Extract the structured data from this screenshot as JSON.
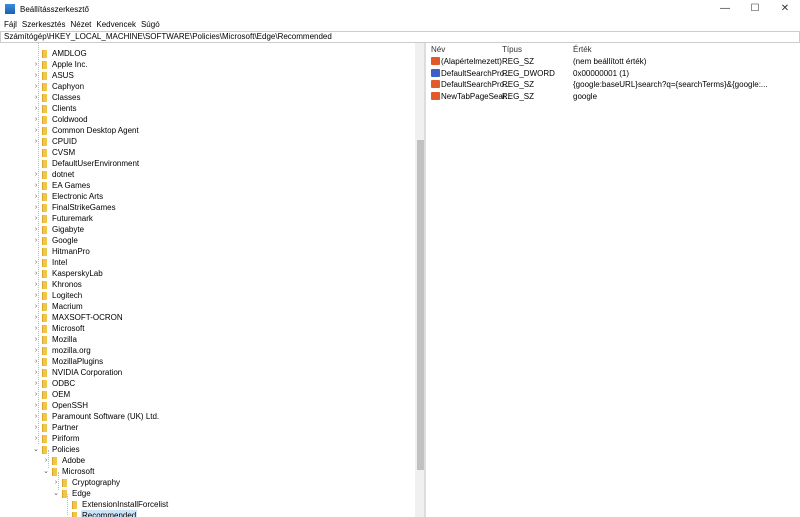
{
  "window": {
    "title": "Beállításszerkesztő",
    "minimize": "—",
    "maximize": "☐",
    "close": "✕"
  },
  "menu": [
    "Fájl",
    "Szerkesztés",
    "Nézet",
    "Kedvencek",
    "Súgó"
  ],
  "address": "Számítógép\\HKEY_LOCAL_MACHINE\\SOFTWARE\\Policies\\Microsoft\\Edge\\Recommended",
  "tree": [
    {
      "label": "AMDLOG",
      "level": 0,
      "exp": ""
    },
    {
      "label": "Apple Inc.",
      "level": 0,
      "exp": ">"
    },
    {
      "label": "ASUS",
      "level": 0,
      "exp": ">"
    },
    {
      "label": "Caphyon",
      "level": 0,
      "exp": ">"
    },
    {
      "label": "Classes",
      "level": 0,
      "exp": ">"
    },
    {
      "label": "Clients",
      "level": 0,
      "exp": ">"
    },
    {
      "label": "Coldwood",
      "level": 0,
      "exp": ">"
    },
    {
      "label": "Common Desktop Agent",
      "level": 0,
      "exp": ">"
    },
    {
      "label": "CPUID",
      "level": 0,
      "exp": ">"
    },
    {
      "label": "CVSM",
      "level": 0,
      "exp": ""
    },
    {
      "label": "DefaultUserEnvironment",
      "level": 0,
      "exp": ""
    },
    {
      "label": "dotnet",
      "level": 0,
      "exp": ">"
    },
    {
      "label": "EA Games",
      "level": 0,
      "exp": ">"
    },
    {
      "label": "Electronic Arts",
      "level": 0,
      "exp": ">"
    },
    {
      "label": "FinalStrikeGames",
      "level": 0,
      "exp": ">"
    },
    {
      "label": "Futuremark",
      "level": 0,
      "exp": ">"
    },
    {
      "label": "Gigabyte",
      "level": 0,
      "exp": ">"
    },
    {
      "label": "Google",
      "level": 0,
      "exp": ">"
    },
    {
      "label": "HitmanPro",
      "level": 0,
      "exp": ""
    },
    {
      "label": "Intel",
      "level": 0,
      "exp": ">"
    },
    {
      "label": "KasperskyLab",
      "level": 0,
      "exp": ">"
    },
    {
      "label": "Khronos",
      "level": 0,
      "exp": ">"
    },
    {
      "label": "Logitech",
      "level": 0,
      "exp": ">"
    },
    {
      "label": "Macrium",
      "level": 0,
      "exp": ">"
    },
    {
      "label": "MAXSOFT-OCRON",
      "level": 0,
      "exp": ">"
    },
    {
      "label": "Microsoft",
      "level": 0,
      "exp": ">"
    },
    {
      "label": "Mozilla",
      "level": 0,
      "exp": ">"
    },
    {
      "label": "mozilla.org",
      "level": 0,
      "exp": ">"
    },
    {
      "label": "MozillaPlugins",
      "level": 0,
      "exp": ">"
    },
    {
      "label": "NVIDIA Corporation",
      "level": 0,
      "exp": ">"
    },
    {
      "label": "ODBC",
      "level": 0,
      "exp": ">"
    },
    {
      "label": "OEM",
      "level": 0,
      "exp": ">"
    },
    {
      "label": "OpenSSH",
      "level": 0,
      "exp": ">"
    },
    {
      "label": "Paramount Software (UK) Ltd.",
      "level": 0,
      "exp": ">"
    },
    {
      "label": "Partner",
      "level": 0,
      "exp": ">"
    },
    {
      "label": "Piriform",
      "level": 0,
      "exp": ">"
    },
    {
      "label": "Policies",
      "level": 0,
      "exp": "v"
    },
    {
      "label": "Adobe",
      "level": 1,
      "exp": ">"
    },
    {
      "label": "Microsoft",
      "level": 1,
      "exp": "v"
    },
    {
      "label": "Cryptography",
      "level": 2,
      "exp": ">"
    },
    {
      "label": "Edge",
      "level": 2,
      "exp": "v"
    },
    {
      "label": "ExtensionInstallForcelist",
      "level": 3,
      "exp": ""
    },
    {
      "label": "Recommended",
      "level": 3,
      "exp": "",
      "selected": true
    }
  ],
  "columns": {
    "name": "Név",
    "type": "Típus",
    "value": "Érték"
  },
  "values": [
    {
      "name": "(Alapértelmezett)",
      "type": "REG_SZ",
      "value": "(nem beállított érték)",
      "icon": "sz"
    },
    {
      "name": "DefaultSearchPro...",
      "type": "REG_DWORD",
      "value": "0x00000001 (1)",
      "icon": "dw"
    },
    {
      "name": "DefaultSearchPro...",
      "type": "REG_SZ",
      "value": "{google:baseURL}search?q={searchTerms}&{google:...",
      "icon": "sz"
    },
    {
      "name": "NewTabPageSear...",
      "type": "REG_SZ",
      "value": "google",
      "icon": "sz"
    }
  ]
}
